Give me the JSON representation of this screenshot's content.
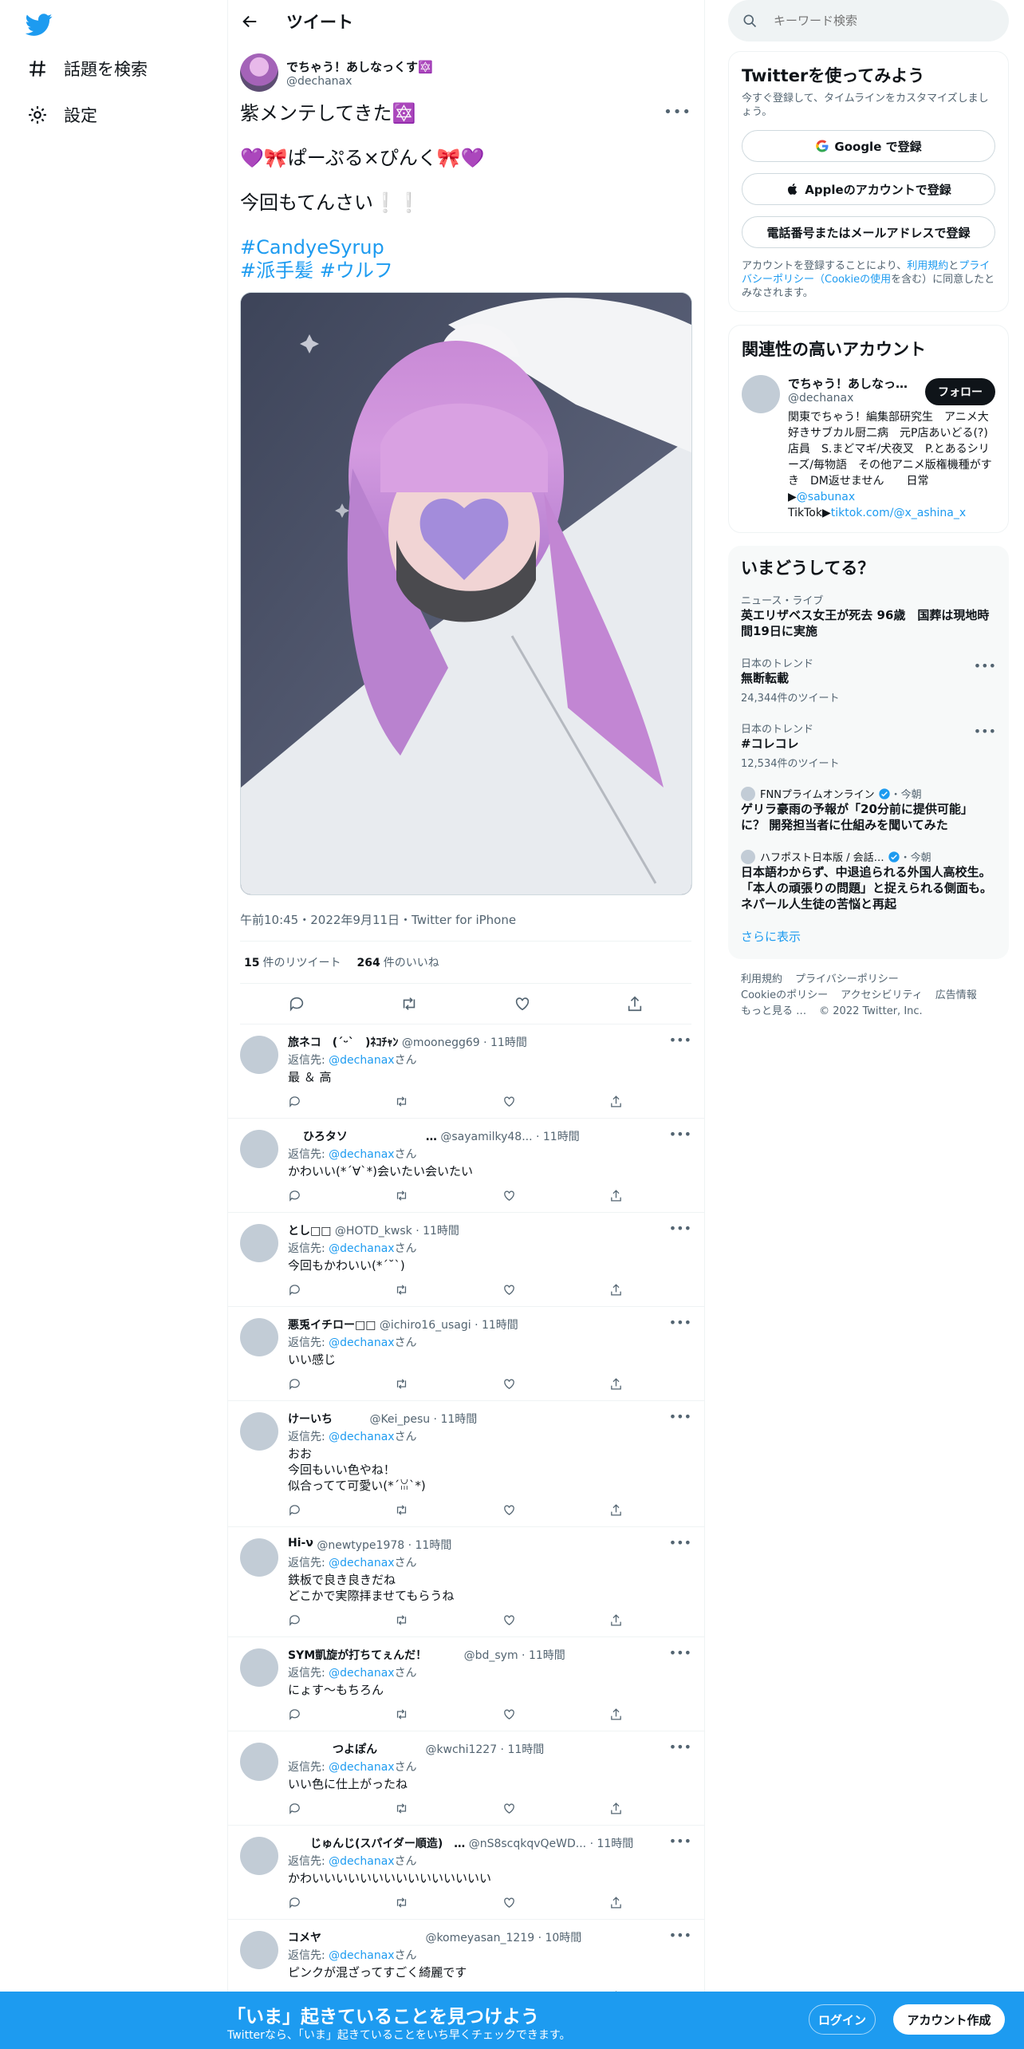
{
  "nav": {
    "explore_label": "話題を検索",
    "settings_label": "設定"
  },
  "header": {
    "title": "ツイート"
  },
  "tweet": {
    "author_name": "でちゃう！あしなっくす🔯",
    "author_handle": "@dechanax",
    "line1": "紫メンテしてきた🔯",
    "line2": "💜🎀ぱーぷる×ぴんく🎀💜",
    "line3": "今回もてんさい❕❕",
    "hashtag1": "#CandyeSyrup",
    "hashtag2": "#派手髪",
    "hashtag3": "#ウルフ",
    "timestamp": "午前10:45・2022年9月11日・Twitter for iPhone",
    "retweets_count": "15",
    "retweets_label": "件のリツイート",
    "likes_count": "264",
    "likes_label": "件のいいね"
  },
  "replies": [
    {
      "name": "旅ネコ　(ˊᵕˋ　)ﾈｺﾁｬﾝ",
      "handle": "@moonegg69 · 11時間",
      "to_prefix": "返信先: ",
      "to_user": "@dechanax",
      "to_suffix": "さん",
      "body": [
        "最 ＆ 高"
      ]
    },
    {
      "name": "　 ひろタソ　　　　　　　…",
      "handle": "@sayamilky48... · 11時間",
      "to_prefix": "返信先: ",
      "to_user": "@dechanax",
      "to_suffix": "さん",
      "body": [
        "かわいい(*´∀`*)会いたい会いたい"
      ]
    },
    {
      "name": "とし□□",
      "handle": "@HOTD_kwsk · 11時間",
      "to_prefix": "返信先: ",
      "to_user": "@dechanax",
      "to_suffix": "さん",
      "body": [
        "今回もかわいい(*´˘`)"
      ]
    },
    {
      "name": "悪兎イチロー□□",
      "handle": "@ichiro16_usagi · 11時間",
      "to_prefix": "返信先: ",
      "to_user": "@dechanax",
      "to_suffix": "さん",
      "body": [
        "いい感じ"
      ]
    },
    {
      "name": "けーいち　　　",
      "handle": "@Kei_pesu · 11時間",
      "to_prefix": "返信先: ",
      "to_user": "@dechanax",
      "to_suffix": "さん",
      "body": [
        "おお",
        "今回もいい色やね！",
        "似合ってて可愛い(*´ꈍ`*)"
      ]
    },
    {
      "name": "Hi-ν",
      "handle": "@newtype1978 · 11時間",
      "to_prefix": "返信先: ",
      "to_user": "@dechanax",
      "to_suffix": "さん",
      "body": [
        "鉄板で良き良きだね",
        "どこかで実際拝ませてもらうね"
      ]
    },
    {
      "name": "SYM凱旋が打ちてぇんだ！　　　",
      "handle": "@bd_sym · 11時間",
      "to_prefix": "返信先: ",
      "to_user": "@dechanax",
      "to_suffix": "さん",
      "body": [
        "にょす〜もちろん"
      ]
    },
    {
      "name": "　　　　つよぽん　　　　",
      "handle": "@kwchi1227 · 11時間",
      "to_prefix": "返信先: ",
      "to_user": "@dechanax",
      "to_suffix": "さん",
      "body": [
        "いい色に仕上がったね"
      ]
    },
    {
      "name": "　　じゅんじ(スパイダー順造)　…",
      "handle": "@nS8scqkqvQeWD... · 11時間",
      "to_prefix": "返信先: ",
      "to_user": "@dechanax",
      "to_suffix": "さん",
      "body": [
        "かわいいいいいいいいいいいいいいい"
      ]
    },
    {
      "name": "コメヤ　　　　　　　　　",
      "handle": "@komeyasan_1219 · 10時間",
      "to_prefix": "返信先: ",
      "to_user": "@dechanax",
      "to_suffix": "さん",
      "body": [
        "ピンクが混ざってすごく綺麗です"
      ]
    }
  ],
  "search": {
    "placeholder": "キーワード検索"
  },
  "signup_card": {
    "title": "Twitterを使ってみよう",
    "desc": "今すぐ登録して、タイムラインをカスタマイズしましょう。",
    "google": "Google で登録",
    "apple": "Appleのアカウントで登録",
    "phone": "電話番号またはメールアドレスで登録",
    "terms_prefix": "アカウントを登録することにより、",
    "terms_link1": "利用規約",
    "terms_mid": "と",
    "terms_link2": "プライバシーポリシー（Cookieの使用",
    "terms_suffix": "を含む）に同意したとみなされます。"
  },
  "related_card": {
    "title": "関連性の高いアカウント",
    "name": "でちゃう！あしなっ…",
    "handle": "@dechanax",
    "follow": "フォロー",
    "bio": "関東でちゃう！編集部研究生　アニメ大好きサブカル厨二病　元P店あいどる(?)店員　S.まどマギ/犬夜叉　P.とあるシリーズ/毎物語　その他アニメ版権機種がすき　DM返せません　　日常▶",
    "bio_link1": "@sabunax",
    "bio_mid": " TikTok▶",
    "bio_link2": "tiktok.com/@x_ashina_x"
  },
  "trends": {
    "title": "いまどうしてる？",
    "items": [
      {
        "category": "ニュース・ライブ",
        "title": "英エリザベス女王が死去 96歳　国葬は現地時間19日に実施",
        "count": ""
      },
      {
        "category": "日本のトレンド",
        "title": "無断転載",
        "count": "24,344件のツイート"
      },
      {
        "category": "日本のトレンド",
        "title": "#コレコレ",
        "count": "12,534件のツイート"
      }
    ],
    "news": [
      {
        "source": "FNNプライムオンライン",
        "time": "・今朝",
        "title": "ゲリラ豪雨の予報が「20分前に提供可能」に？ 開発担当者に仕組みを聞いてみた"
      },
      {
        "source": "ハフポスト日本版 / 会話…",
        "time": "・今朝",
        "title": "日本語わからず、中退追られる外国人高校生。「本人の頑張りの問題」と捉えられる側面も。ネパール人生徒の苦悩と再起"
      }
    ],
    "more": "さらに表示"
  },
  "footer": {
    "terms": "利用規約",
    "privacy": "プライバシーポリシー",
    "cookie": "Cookieのポリシー",
    "access": "アクセシビリティ",
    "ads": "広告情報",
    "more": "もっと見る …",
    "copyright": "© 2022 Twitter, Inc."
  },
  "banner": {
    "headline": "「いま」起きていることを見つけよう",
    "sub": "Twitterなら、「いま」起きていることをいち早くチェックできます。",
    "login": "ログイン",
    "signup": "アカウント作成"
  },
  "colors": {
    "accent": "#1d9bf0",
    "text": "#0f1419",
    "muted": "#536471"
  }
}
